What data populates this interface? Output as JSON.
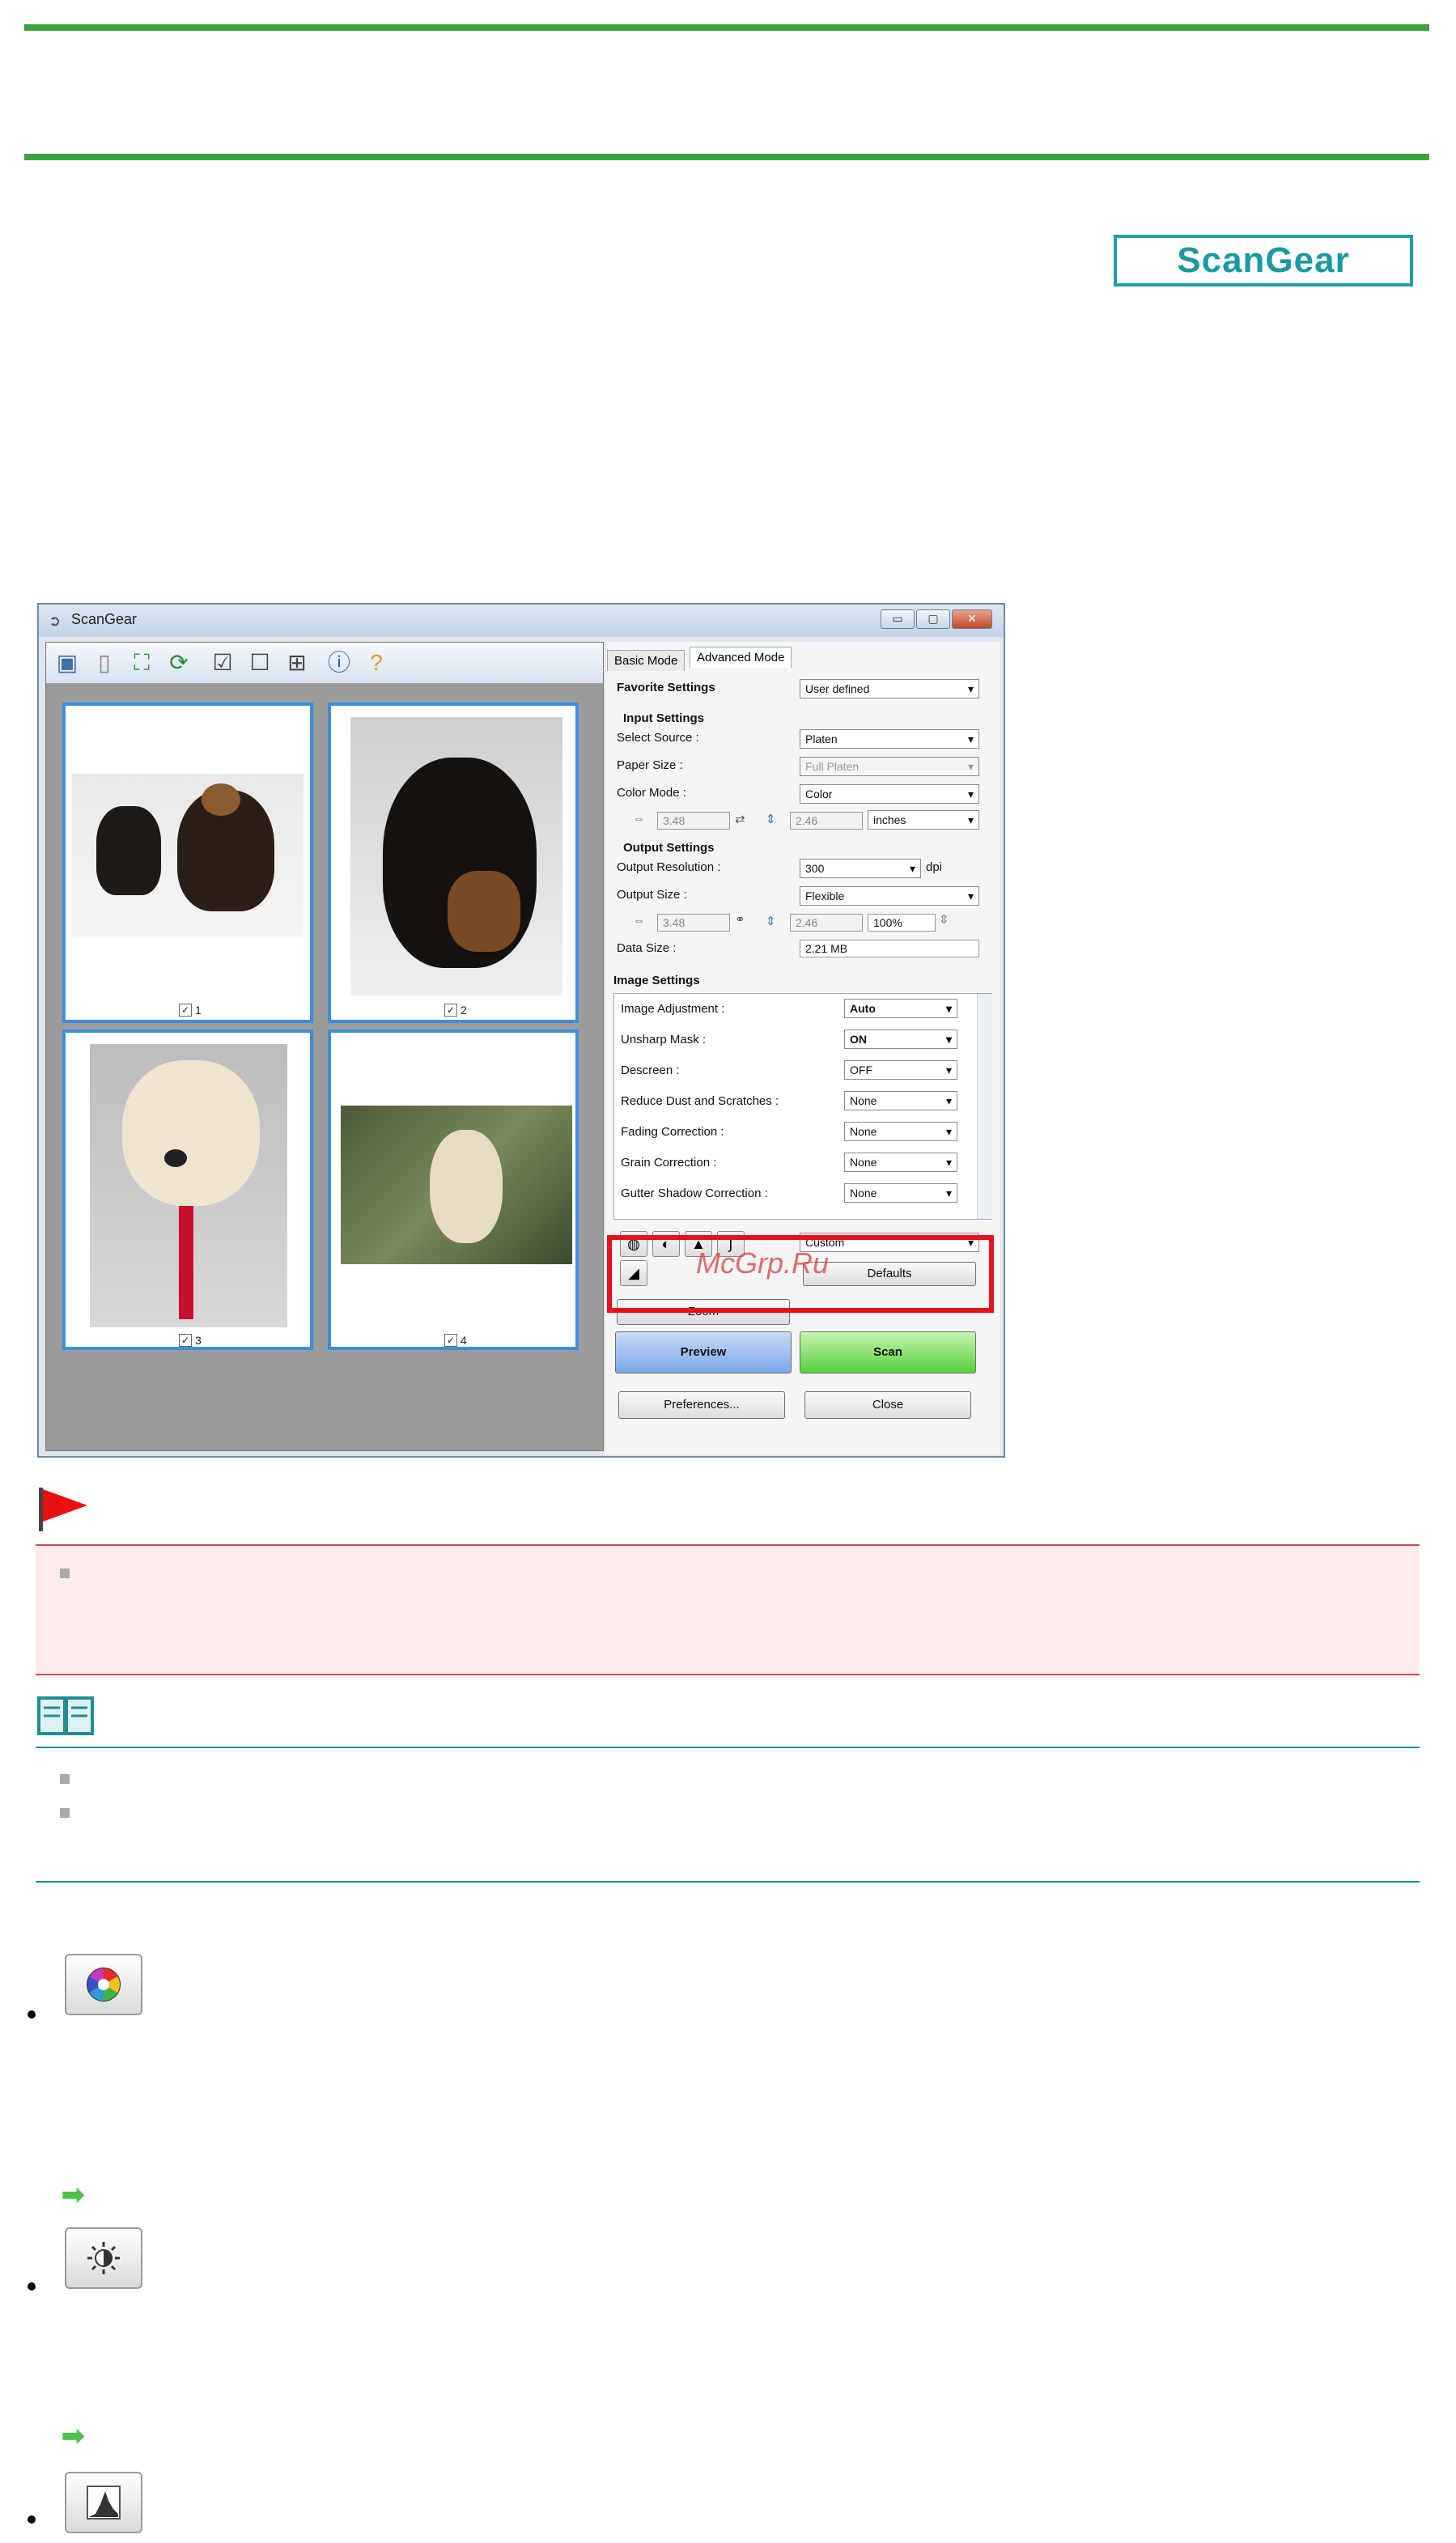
{
  "logo": {
    "text": "ScanGear"
  },
  "window": {
    "title": "ScanGear",
    "controls": {
      "minimize": "▭",
      "maximize": "▢",
      "close": "✕"
    },
    "thumbnails": [
      {
        "num": "1"
      },
      {
        "num": "2"
      },
      {
        "num": "3"
      },
      {
        "num": "4"
      }
    ],
    "tabs": {
      "basic": "Basic Mode",
      "advanced": "Advanced Mode"
    },
    "favorite": {
      "label": "Favorite Settings",
      "value": "User defined"
    },
    "input": {
      "heading": "Input Settings",
      "select_source_label": "Select Source :",
      "select_source": "Platen",
      "paper_size_label": "Paper Size :",
      "paper_size": "Full Platen",
      "color_mode_label": "Color Mode :",
      "color_mode": "Color",
      "width": "3.48",
      "height": "2.46",
      "units": "inches"
    },
    "output": {
      "heading": "Output Settings",
      "resolution_label": "Output Resolution :",
      "resolution": "300",
      "dpi": "dpi",
      "size_label": "Output Size :",
      "size": "Flexible",
      "width": "3.48",
      "height": "2.46",
      "scale": "100%",
      "data_size_label": "Data Size :",
      "data_size": "2.21 MB"
    },
    "image": {
      "heading": "Image Settings",
      "rows": [
        {
          "label": "Image Adjustment :",
          "value": "Auto"
        },
        {
          "label": "Unsharp Mask :",
          "value": "ON"
        },
        {
          "label": "Descreen :",
          "value": "OFF"
        },
        {
          "label": "Reduce Dust and Scratches :",
          "value": "None"
        },
        {
          "label": "Fading Correction :",
          "value": "None"
        },
        {
          "label": "Grain Correction :",
          "value": "None"
        },
        {
          "label": "Gutter Shadow Correction :",
          "value": "None"
        }
      ]
    },
    "custom": "Custom",
    "defaults": "Defaults",
    "watermark": "McGrp.Ru",
    "zoom": "Zoom",
    "preview": "Preview",
    "scan": "Scan",
    "preferences": "Preferences...",
    "close": "Close"
  },
  "colors": {
    "accent_green": "#3aa43a",
    "important_red": "#e8101a",
    "note_teal": "#1f8f95"
  }
}
